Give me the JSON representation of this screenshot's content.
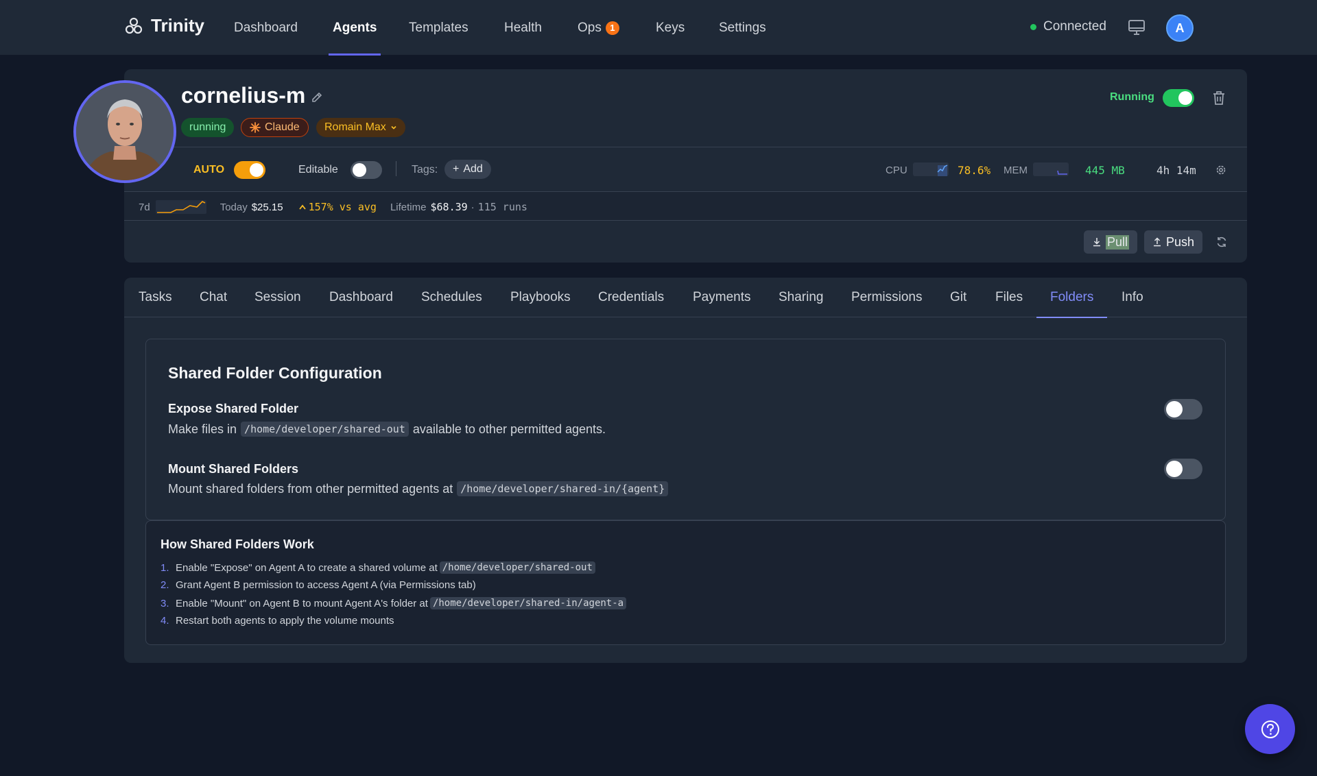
{
  "nav": {
    "brand": "Trinity",
    "items": [
      "Dashboard",
      "Agents",
      "Templates",
      "Health",
      "Ops",
      "Keys",
      "Settings"
    ],
    "active": "Agents",
    "ops_badge": "1",
    "connection_status": "Connected",
    "user_initial": "A"
  },
  "agent": {
    "name": "cornelius-m",
    "status_pill": "running",
    "model_pill": "Claude",
    "owner_pill": "Romain Max",
    "running_label": "Running",
    "auto_label": "AUTO",
    "editable_label": "Editable",
    "tags_label": "Tags:",
    "add_tag_label": "Add",
    "cpu_label": "CPU",
    "cpu_value": "78.6%",
    "mem_label": "MEM",
    "mem_value": "445 MB",
    "uptime": "4h 14m",
    "running_on": true,
    "auto_on": true,
    "editable_on": false
  },
  "cost": {
    "period": "7d",
    "today_label": "Today",
    "today_value": "$25.15",
    "change": "157% vs avg",
    "lifetime_label": "Lifetime",
    "lifetime_value": "$68.39",
    "separator": "·",
    "runs": "115 runs"
  },
  "actions": {
    "pull_label": "Pull",
    "push_label": "Push"
  },
  "tabs": {
    "items": [
      "Tasks",
      "Chat",
      "Session",
      "Dashboard",
      "Schedules",
      "Playbooks",
      "Credentials",
      "Payments",
      "Sharing",
      "Permissions",
      "Git",
      "Files",
      "Folders",
      "Info"
    ],
    "active": "Folders"
  },
  "folders": {
    "title": "Shared Folder Configuration",
    "expose_title": "Expose Shared Folder",
    "expose_desc_pre": "Make files in",
    "expose_path": "/home/developer/shared-out",
    "expose_desc_post": "available to other permitted agents.",
    "expose_on": false,
    "mount_title": "Mount Shared Folders",
    "mount_desc_pre": "Mount shared folders from other permitted agents at",
    "mount_path": "/home/developer/shared-in/{agent}",
    "mount_on": false
  },
  "how": {
    "title": "How Shared Folders Work",
    "steps": [
      {
        "num": "1.",
        "text": "Enable \"Expose\" on Agent A to create a shared volume at",
        "code": "/home/developer/shared-out"
      },
      {
        "num": "2.",
        "text": "Grant Agent B permission to access Agent A (via Permissions tab)",
        "code": ""
      },
      {
        "num": "3.",
        "text": "Enable \"Mount\" on Agent B to mount Agent A's folder at",
        "code": "/home/developer/shared-in/agent-a"
      },
      {
        "num": "4.",
        "text": "Restart both agents to apply the volume mounts",
        "code": ""
      }
    ]
  },
  "colors": {
    "accent": "#6366f1",
    "running_green": "#22c55e",
    "auto_amber": "#f59e0b",
    "cpu_amber": "#fbbf24",
    "mem_green": "#4ade80"
  }
}
